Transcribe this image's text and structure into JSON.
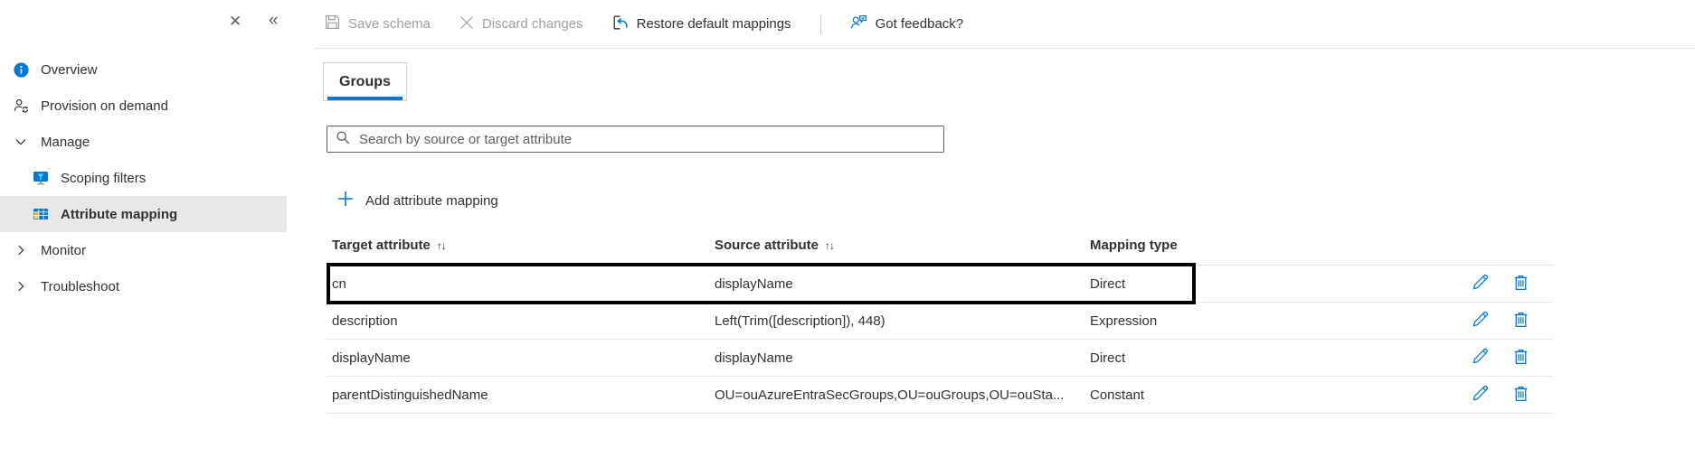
{
  "panel": {
    "close_glyph": "✕",
    "collapse_glyph": "«"
  },
  "sidebar": {
    "items": [
      {
        "label": "Overview",
        "icon": "info-icon"
      },
      {
        "label": "Provision on demand",
        "icon": "person-sync-icon"
      },
      {
        "label": "Manage",
        "icon": "chevron-down-icon",
        "expanded": true
      },
      {
        "label": "Scoping filters",
        "icon": "scoping-filters-icon",
        "indent": true
      },
      {
        "label": "Attribute mapping",
        "icon": "attribute-mapping-icon",
        "indent": true,
        "selected": true
      },
      {
        "label": "Monitor",
        "icon": "chevron-right-icon"
      },
      {
        "label": "Troubleshoot",
        "icon": "chevron-right-icon"
      }
    ]
  },
  "toolbar": {
    "save_label": "Save schema",
    "save_enabled": false,
    "discard_label": "Discard changes",
    "discard_enabled": false,
    "restore_label": "Restore default mappings",
    "restore_enabled": true,
    "feedback_label": "Got feedback?",
    "feedback_enabled": true
  },
  "tabs": [
    {
      "label": "Groups",
      "active": true
    }
  ],
  "search": {
    "placeholder": "Search by source or target attribute",
    "value": ""
  },
  "add_mapping": {
    "label": "Add attribute mapping",
    "icon": "plus-icon"
  },
  "table": {
    "sort_icon": "↑↓",
    "columns": [
      {
        "label": "Target attribute",
        "sortable": true
      },
      {
        "label": "Source attribute",
        "sortable": true
      },
      {
        "label": "Mapping type",
        "sortable": false
      }
    ],
    "rows": [
      {
        "target": "cn",
        "source": "displayName",
        "type": "Direct",
        "highlighted": true
      },
      {
        "target": "description",
        "source": "Left(Trim([description]), 448)",
        "type": "Expression",
        "highlighted": false
      },
      {
        "target": "displayName",
        "source": "displayName",
        "type": "Direct",
        "highlighted": false
      },
      {
        "target": "parentDistinguishedName",
        "source": "OU=ouAzureEntraSecGroups,OU=ouGroups,OU=ouSta...",
        "type": "Constant",
        "highlighted": false
      }
    ],
    "row_actions": [
      "edit",
      "delete"
    ]
  },
  "colors": {
    "accent": "#0078d4",
    "text": "#323130",
    "disabled_text": "#a19f9d",
    "selected_item_bg": "#e8e8e8",
    "highlight_border": "#000000",
    "icon_yellow": "#ffb900"
  }
}
